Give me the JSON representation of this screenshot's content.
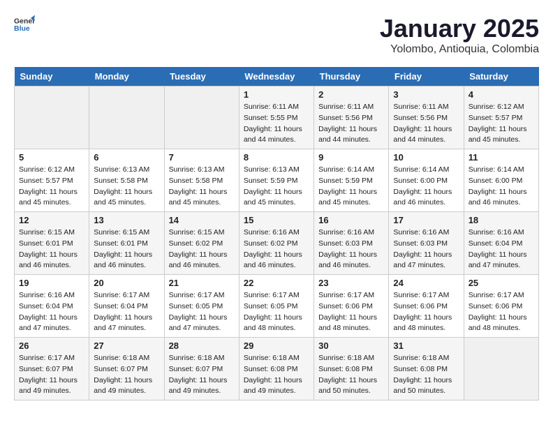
{
  "header": {
    "logo_general": "General",
    "logo_blue": "Blue",
    "title": "January 2025",
    "subtitle": "Yolombo, Antioquia, Colombia"
  },
  "days_of_week": [
    "Sunday",
    "Monday",
    "Tuesday",
    "Wednesday",
    "Thursday",
    "Friday",
    "Saturday"
  ],
  "weeks": [
    [
      {
        "day": "",
        "sunrise": "",
        "sunset": "",
        "daylight": ""
      },
      {
        "day": "",
        "sunrise": "",
        "sunset": "",
        "daylight": ""
      },
      {
        "day": "",
        "sunrise": "",
        "sunset": "",
        "daylight": ""
      },
      {
        "day": "1",
        "sunrise": "Sunrise: 6:11 AM",
        "sunset": "Sunset: 5:55 PM",
        "daylight": "Daylight: 11 hours and 44 minutes."
      },
      {
        "day": "2",
        "sunrise": "Sunrise: 6:11 AM",
        "sunset": "Sunset: 5:56 PM",
        "daylight": "Daylight: 11 hours and 44 minutes."
      },
      {
        "day": "3",
        "sunrise": "Sunrise: 6:11 AM",
        "sunset": "Sunset: 5:56 PM",
        "daylight": "Daylight: 11 hours and 44 minutes."
      },
      {
        "day": "4",
        "sunrise": "Sunrise: 6:12 AM",
        "sunset": "Sunset: 5:57 PM",
        "daylight": "Daylight: 11 hours and 45 minutes."
      }
    ],
    [
      {
        "day": "5",
        "sunrise": "Sunrise: 6:12 AM",
        "sunset": "Sunset: 5:57 PM",
        "daylight": "Daylight: 11 hours and 45 minutes."
      },
      {
        "day": "6",
        "sunrise": "Sunrise: 6:13 AM",
        "sunset": "Sunset: 5:58 PM",
        "daylight": "Daylight: 11 hours and 45 minutes."
      },
      {
        "day": "7",
        "sunrise": "Sunrise: 6:13 AM",
        "sunset": "Sunset: 5:58 PM",
        "daylight": "Daylight: 11 hours and 45 minutes."
      },
      {
        "day": "8",
        "sunrise": "Sunrise: 6:13 AM",
        "sunset": "Sunset: 5:59 PM",
        "daylight": "Daylight: 11 hours and 45 minutes."
      },
      {
        "day": "9",
        "sunrise": "Sunrise: 6:14 AM",
        "sunset": "Sunset: 5:59 PM",
        "daylight": "Daylight: 11 hours and 45 minutes."
      },
      {
        "day": "10",
        "sunrise": "Sunrise: 6:14 AM",
        "sunset": "Sunset: 6:00 PM",
        "daylight": "Daylight: 11 hours and 46 minutes."
      },
      {
        "day": "11",
        "sunrise": "Sunrise: 6:14 AM",
        "sunset": "Sunset: 6:00 PM",
        "daylight": "Daylight: 11 hours and 46 minutes."
      }
    ],
    [
      {
        "day": "12",
        "sunrise": "Sunrise: 6:15 AM",
        "sunset": "Sunset: 6:01 PM",
        "daylight": "Daylight: 11 hours and 46 minutes."
      },
      {
        "day": "13",
        "sunrise": "Sunrise: 6:15 AM",
        "sunset": "Sunset: 6:01 PM",
        "daylight": "Daylight: 11 hours and 46 minutes."
      },
      {
        "day": "14",
        "sunrise": "Sunrise: 6:15 AM",
        "sunset": "Sunset: 6:02 PM",
        "daylight": "Daylight: 11 hours and 46 minutes."
      },
      {
        "day": "15",
        "sunrise": "Sunrise: 6:16 AM",
        "sunset": "Sunset: 6:02 PM",
        "daylight": "Daylight: 11 hours and 46 minutes."
      },
      {
        "day": "16",
        "sunrise": "Sunrise: 6:16 AM",
        "sunset": "Sunset: 6:03 PM",
        "daylight": "Daylight: 11 hours and 46 minutes."
      },
      {
        "day": "17",
        "sunrise": "Sunrise: 6:16 AM",
        "sunset": "Sunset: 6:03 PM",
        "daylight": "Daylight: 11 hours and 47 minutes."
      },
      {
        "day": "18",
        "sunrise": "Sunrise: 6:16 AM",
        "sunset": "Sunset: 6:04 PM",
        "daylight": "Daylight: 11 hours and 47 minutes."
      }
    ],
    [
      {
        "day": "19",
        "sunrise": "Sunrise: 6:16 AM",
        "sunset": "Sunset: 6:04 PM",
        "daylight": "Daylight: 11 hours and 47 minutes."
      },
      {
        "day": "20",
        "sunrise": "Sunrise: 6:17 AM",
        "sunset": "Sunset: 6:04 PM",
        "daylight": "Daylight: 11 hours and 47 minutes."
      },
      {
        "day": "21",
        "sunrise": "Sunrise: 6:17 AM",
        "sunset": "Sunset: 6:05 PM",
        "daylight": "Daylight: 11 hours and 47 minutes."
      },
      {
        "day": "22",
        "sunrise": "Sunrise: 6:17 AM",
        "sunset": "Sunset: 6:05 PM",
        "daylight": "Daylight: 11 hours and 48 minutes."
      },
      {
        "day": "23",
        "sunrise": "Sunrise: 6:17 AM",
        "sunset": "Sunset: 6:06 PM",
        "daylight": "Daylight: 11 hours and 48 minutes."
      },
      {
        "day": "24",
        "sunrise": "Sunrise: 6:17 AM",
        "sunset": "Sunset: 6:06 PM",
        "daylight": "Daylight: 11 hours and 48 minutes."
      },
      {
        "day": "25",
        "sunrise": "Sunrise: 6:17 AM",
        "sunset": "Sunset: 6:06 PM",
        "daylight": "Daylight: 11 hours and 48 minutes."
      }
    ],
    [
      {
        "day": "26",
        "sunrise": "Sunrise: 6:17 AM",
        "sunset": "Sunset: 6:07 PM",
        "daylight": "Daylight: 11 hours and 49 minutes."
      },
      {
        "day": "27",
        "sunrise": "Sunrise: 6:18 AM",
        "sunset": "Sunset: 6:07 PM",
        "daylight": "Daylight: 11 hours and 49 minutes."
      },
      {
        "day": "28",
        "sunrise": "Sunrise: 6:18 AM",
        "sunset": "Sunset: 6:07 PM",
        "daylight": "Daylight: 11 hours and 49 minutes."
      },
      {
        "day": "29",
        "sunrise": "Sunrise: 6:18 AM",
        "sunset": "Sunset: 6:08 PM",
        "daylight": "Daylight: 11 hours and 49 minutes."
      },
      {
        "day": "30",
        "sunrise": "Sunrise: 6:18 AM",
        "sunset": "Sunset: 6:08 PM",
        "daylight": "Daylight: 11 hours and 50 minutes."
      },
      {
        "day": "31",
        "sunrise": "Sunrise: 6:18 AM",
        "sunset": "Sunset: 6:08 PM",
        "daylight": "Daylight: 11 hours and 50 minutes."
      },
      {
        "day": "",
        "sunrise": "",
        "sunset": "",
        "daylight": ""
      }
    ]
  ]
}
